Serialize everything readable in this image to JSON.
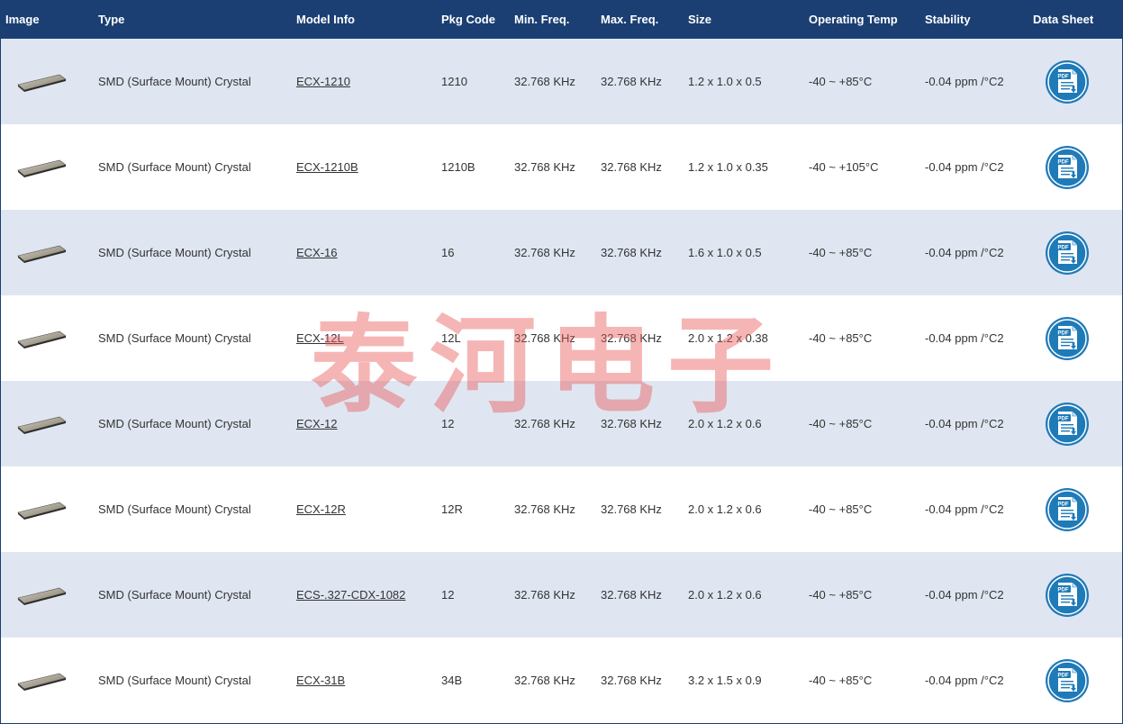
{
  "colors": {
    "header_bg": "#1b3f73",
    "row_alt_bg": "#dfe6f1",
    "pdf_blue": "#1f7ab8",
    "watermark": "#e85a5a"
  },
  "header": {
    "image": "Image",
    "type": "Type",
    "model": "Model Info",
    "pkg": "Pkg Code",
    "min": "Min. Freq.",
    "max": "Max. Freq.",
    "size": "Size",
    "temp": "Operating Temp",
    "stability": "Stability",
    "datasheet": "Data Sheet"
  },
  "pdf_icon_label": "PDF",
  "rows": [
    {
      "type": "SMD (Surface Mount) Crystal",
      "model": "ECX-1210",
      "pkg": "1210",
      "min": "32.768 KHz",
      "max": "32.768 KHz",
      "size": "1.2 x 1.0 x 0.5",
      "temp": "-40 ~ +85°C",
      "stability": "-0.04 ppm /°C2"
    },
    {
      "type": "SMD (Surface Mount) Crystal",
      "model": "ECX-1210B",
      "pkg": "1210B",
      "min": "32.768 KHz",
      "max": "32.768 KHz",
      "size": "1.2 x 1.0 x 0.35",
      "temp": "-40 ~ +105°C",
      "stability": "-0.04 ppm /°C2"
    },
    {
      "type": "SMD (Surface Mount) Crystal",
      "model": "ECX-16",
      "pkg": "16",
      "min": "32.768 KHz",
      "max": "32.768 KHz",
      "size": "1.6 x 1.0 x 0.5",
      "temp": "-40 ~ +85°C",
      "stability": "-0.04 ppm /°C2"
    },
    {
      "type": "SMD (Surface Mount) Crystal",
      "model": "ECX-12L",
      "pkg": "12L",
      "min": "32.768 KHz",
      "max": "32.768 KHz",
      "size": "2.0 x 1.2 x 0.38",
      "temp": "-40 ~ +85°C",
      "stability": "-0.04 ppm /°C2"
    },
    {
      "type": "SMD (Surface Mount) Crystal",
      "model": "ECX-12",
      "pkg": "12",
      "min": "32.768 KHz",
      "max": "32.768 KHz",
      "size": "2.0 x 1.2 x 0.6",
      "temp": "-40 ~ +85°C",
      "stability": "-0.04 ppm /°C2"
    },
    {
      "type": "SMD (Surface Mount) Crystal",
      "model": "ECX-12R",
      "pkg": "12R",
      "min": "32.768 KHz",
      "max": "32.768 KHz",
      "size": "2.0 x 1.2 x 0.6",
      "temp": "-40 ~ +85°C",
      "stability": "-0.04 ppm /°C2"
    },
    {
      "type": "SMD (Surface Mount) Crystal",
      "model": "ECS-.327-CDX-1082",
      "pkg": "12",
      "min": "32.768 KHz",
      "max": "32.768 KHz",
      "size": "2.0 x 1.2 x 0.6",
      "temp": "-40 ~ +85°C",
      "stability": "-0.04 ppm /°C2"
    },
    {
      "type": "SMD (Surface Mount) Crystal",
      "model": "ECX-31B",
      "pkg": "34B",
      "min": "32.768 KHz",
      "max": "32.768 KHz",
      "size": "3.2 x 1.5 x 0.9",
      "temp": "-40 ~ +85°C",
      "stability": "-0.04 ppm /°C2"
    }
  ],
  "watermark_text": "泰河电子"
}
